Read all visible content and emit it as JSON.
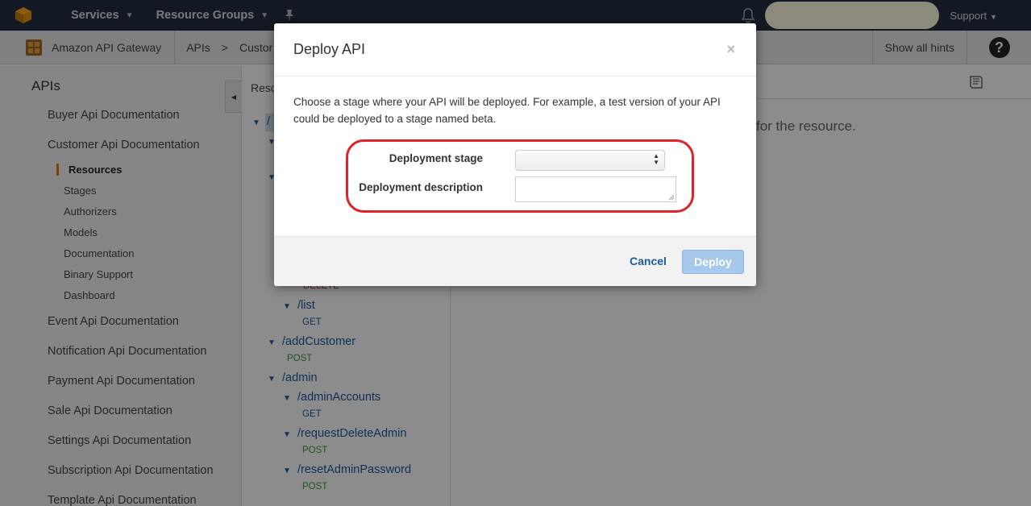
{
  "topbar": {
    "services_label": "Services",
    "resource_groups_label": "Resource Groups",
    "support_label": "Support",
    "logo_icon": "aws-cube-icon",
    "pin_icon": "pin-icon",
    "bell_icon": "bell-icon"
  },
  "breadcrumbs": {
    "service": "Amazon API Gateway",
    "apis": "APIs",
    "separator": ">",
    "current": "Custor",
    "show_hints": "Show all hints",
    "help_icon": "help-icon"
  },
  "sidebar": {
    "title": "APIs",
    "apis": [
      "Buyer Api Documentation",
      "Customer Api Documentation",
      "Event Api Documentation",
      "Notification Api Documentation",
      "Payment Api Documentation",
      "Sale Api Documentation",
      "Settings Api Documentation",
      "Subscription Api Documentation",
      "Template Api Documentation"
    ],
    "subitems": [
      "Resources",
      "Stages",
      "Authorizers",
      "Models",
      "Documentation",
      "Binary Support",
      "Dashboard"
    ],
    "active_accent": "#e47911"
  },
  "tree": {
    "header": "Reso",
    "root": "/",
    "resources": [
      {
        "path": "/list",
        "method": "GET"
      },
      {
        "path": "/addCustomer",
        "method": "POST"
      },
      {
        "path": "/admin",
        "method": ""
      },
      {
        "path": "/adminAccounts",
        "method": "GET"
      },
      {
        "path": "/requestDeleteAdmin",
        "method": "POST"
      },
      {
        "path": "/resetAdminPassword",
        "method": "POST"
      }
    ],
    "partial_method": "DELETE",
    "method_colors": {
      "GET": "#1a5a9e",
      "POST": "#3a9a3a",
      "DELETE": "#c03030"
    }
  },
  "main": {
    "hint_text": "for the resource.",
    "book_icon": "book-icon"
  },
  "modal": {
    "title": "Deploy API",
    "close_icon": "close-icon",
    "close_glyph": "×",
    "description": "Choose a stage where your API will be deployed. For example, a test version of your API could be deployed to a stage named beta.",
    "stage_label": "Deployment stage",
    "stage_value": "",
    "description_label": "Deployment description",
    "description_value": "",
    "cancel_label": "Cancel",
    "deploy_label": "Deploy",
    "highlight_color": "#e0222a"
  }
}
